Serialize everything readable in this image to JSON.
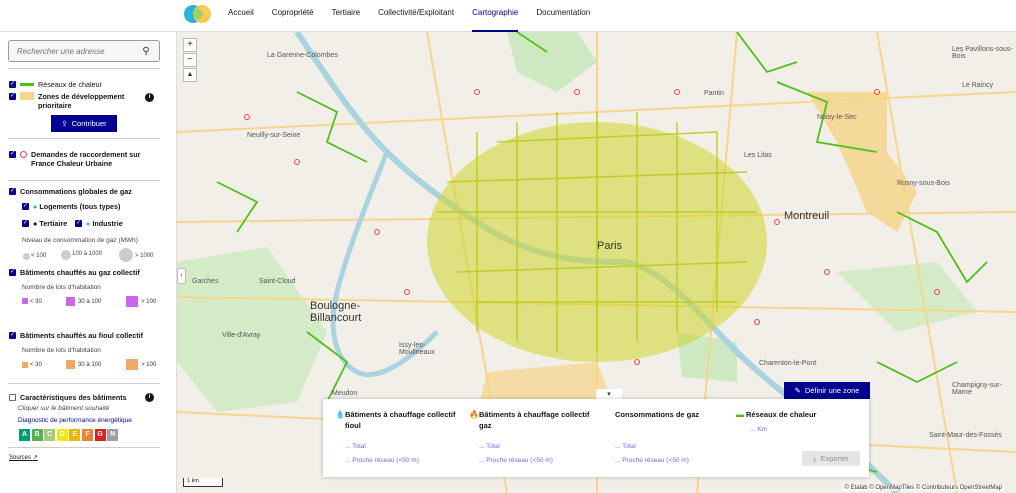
{
  "nav": {
    "items": [
      "Accueil",
      "Copropriété",
      "Tertiaire",
      "Collectivité/Exploitant",
      "Cartographie",
      "Documentation"
    ],
    "active": "Cartographie"
  },
  "search": {
    "placeholder": "Rechercher une adresse"
  },
  "layers": {
    "reseaux": "Réseaux de chaleur",
    "zones": "Zones de développement prioritaire",
    "contribuer": "Contribuer",
    "demandes": "Demandes de raccordement sur France Chaleur Urbaine",
    "gaz_title": "Consommations globales de gaz",
    "logements": "Logements (tous types)",
    "tertiaire": "Tertiaire",
    "industrie": "Industrie",
    "niveau": "Niveau de consommation de gaz (MWh)",
    "niv_low": "< 100",
    "niv_mid": "100 à 1000",
    "niv_high": "> 1000",
    "bat_gaz": "Bâtiments chauffés au gaz collectif",
    "lots_label": "Nombre de lots d'habitation",
    "lots": [
      "< 30",
      "30 à 100",
      "> 100"
    ],
    "bat_fioul": "Bâtiments chauffés au fioul collectif",
    "carac": "Caractéristiques des bâtiments",
    "carac_hint": "Cliquer sur le bâtiment souhaité",
    "dpe_label": "Diagnostic de performance énergétique",
    "dpe": [
      "A",
      "B",
      "C",
      "D",
      "E",
      "F",
      "G",
      "N"
    ],
    "sources": "Sources"
  },
  "colors": {
    "primary": "#000091",
    "network": "#4fc01a",
    "zone": "#f5d58c",
    "gaz_lots": "#cc66ee",
    "fioul_lots": "#f0a868",
    "dpe": [
      "#009c6d",
      "#52b153",
      "#a5cc74",
      "#f4e70f",
      "#f0b40f",
      "#eb8235",
      "#d7221f",
      "#9e9e9e"
    ]
  },
  "map": {
    "labels": [
      "Pantin",
      "Montreuil",
      "Paris",
      "Boulogne-Billancourt",
      "Noisy-le-Sec",
      "Rosny-sous-Bois",
      "Les Lilas",
      "Neuilly-sur-Seine",
      "La Garenne-Colombes",
      "Garches",
      "Saint-Cloud",
      "Ville-d'Avray",
      "Issy-les-Moulineaux",
      "Charenton-le-Pont",
      "Meudon",
      "Saint-Maur-des-Fossés",
      "Champigny-sur-Marne",
      "Le Raincy",
      "Les Pavillons-sous-Bois"
    ],
    "define_zone": "Définir une zone",
    "scale": "1 km",
    "attribution": "© Etalab © OpenMapTiles © Contributeurs OpenStreetMap"
  },
  "panel": {
    "cols": [
      {
        "title": "Bâtiments à chauffage collectif fioul",
        "links": [
          "... Total",
          "... Proche réseau (<50 m)"
        ]
      },
      {
        "title": "Bâtiments à chauffage collectif gaz",
        "links": [
          "... Total",
          "... Proche réseau (<50 m)"
        ]
      },
      {
        "title": "Consommations de gaz",
        "links": [
          "... Total",
          "... Proche réseau (<50 m)"
        ]
      },
      {
        "title": "Réseaux de chaleur",
        "links": [
          "... Km"
        ]
      }
    ],
    "export": "Exporter"
  }
}
